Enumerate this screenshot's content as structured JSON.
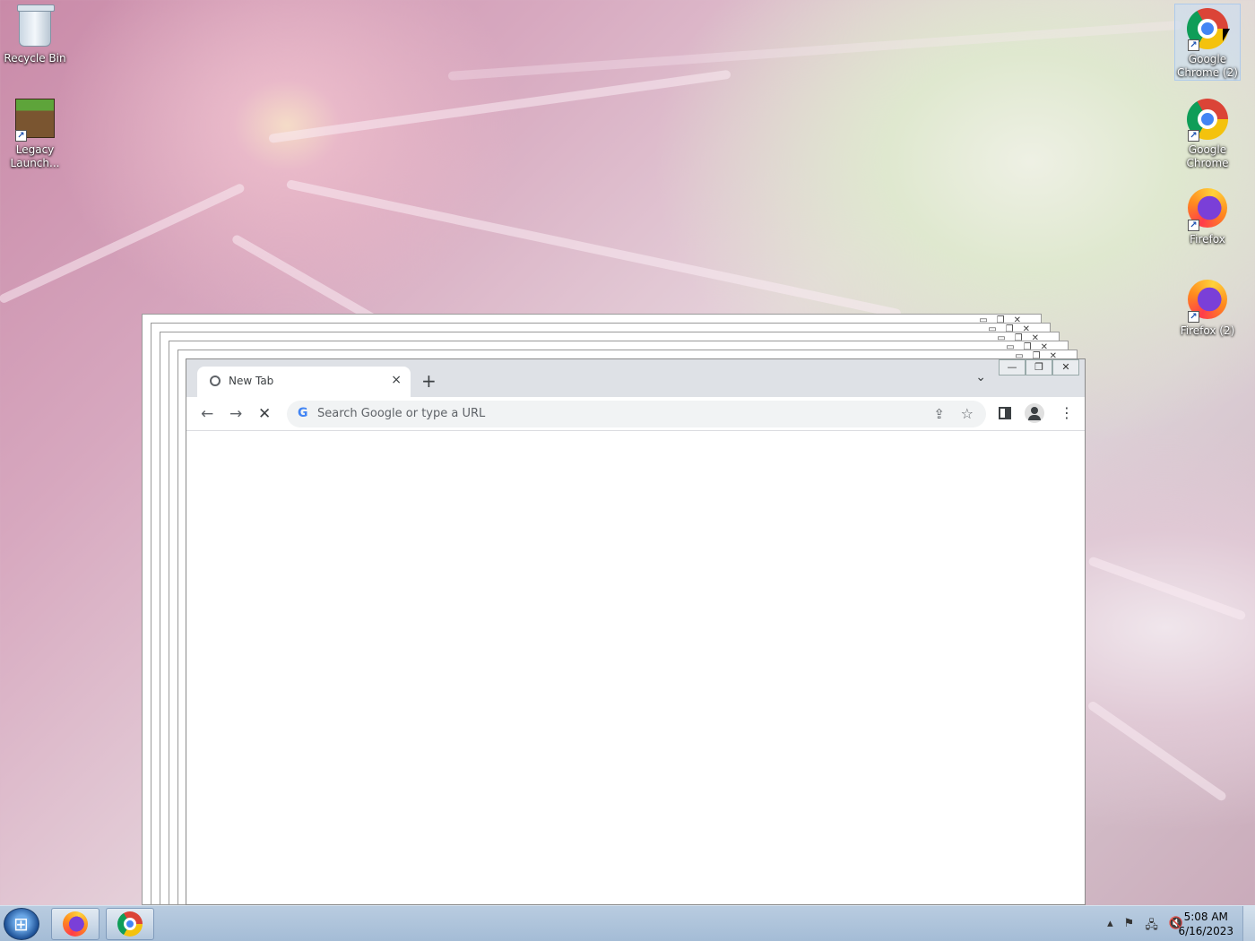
{
  "desktop_icons": {
    "recycle_bin": "Recycle Bin",
    "legacy_launcher": "Legacy Launch...",
    "chrome2": "Google Chrome (2)",
    "chrome": "Google Chrome",
    "firefox": "Firefox",
    "firefox2": "Firefox (2)"
  },
  "browser": {
    "tab_title": "New Tab",
    "tab_close": "×",
    "new_tab": "+",
    "tab_search": "⌄",
    "omnibox_placeholder": "Search Google or type a URL",
    "back": "←",
    "forward": "→",
    "stop": "✕",
    "share": "⇪",
    "star": "☆",
    "menu": "⋮",
    "google_g": "G",
    "minimize": "—",
    "maximize": "❐",
    "close": "✕"
  },
  "taskbar": {
    "time": "5:08 AM",
    "date": "6/16/2023",
    "tray": {
      "expand": "▴",
      "flag": "⚑",
      "network": "🖧",
      "volume": "🔇"
    }
  },
  "colors": {
    "chrome_tab_strip": "#dee1e6",
    "taskbar": "#a4bcd6"
  }
}
